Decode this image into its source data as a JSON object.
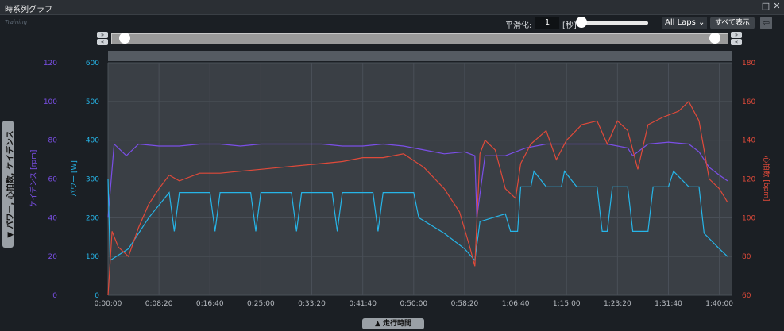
{
  "window": {
    "title": "時系列グラフ",
    "logo_text": "Training",
    "restore_icon": "□",
    "close_icon": "✕"
  },
  "toolbar": {
    "smoothing_label": "平滑化:",
    "smoothing_value": "1",
    "smoothing_unit": "[秒]",
    "laps_label": "All Laps",
    "show_all_label": "すべて表示",
    "exit_icon": "⇦",
    "nav_forward": "»",
    "nav_back": "«"
  },
  "tabs": {
    "side_label": "▼ パワー, 心拍数, ケイデンス",
    "bottom_label": "▲ 走行時間"
  },
  "colors": {
    "cadence": "#7b4fe8",
    "power": "#26b5e8",
    "heart_rate": "#e04a3a",
    "grid": "#4a5058",
    "plot_bg": "#3a3f45"
  },
  "chart_data": {
    "type": "line",
    "x_label": "走行時間",
    "x_ticks": [
      "0:00:00",
      "0:08:20",
      "0:16:40",
      "0:25:00",
      "0:33:20",
      "0:41:40",
      "0:50:00",
      "0:58:20",
      "1:06:40",
      "1:15:00",
      "1:23:20",
      "1:31:40",
      "1:40:00"
    ],
    "x_range_seconds": [
      0,
      6120
    ],
    "axes": {
      "cadence": {
        "label": "ケイデンス [rpm]",
        "range": [
          0,
          120
        ],
        "ticks": [
          "0",
          "20",
          "40",
          "60",
          "80",
          "100",
          "120"
        ]
      },
      "power": {
        "label": "パワー [W]",
        "range": [
          0,
          600
        ],
        "ticks": [
          "0",
          "100",
          "200",
          "300",
          "400",
          "500",
          "600"
        ]
      },
      "heart_rate": {
        "label": "心拍数 [bpm]",
        "range": [
          60,
          180
        ],
        "ticks": [
          "60",
          "80",
          "100",
          "120",
          "140",
          "160",
          "180"
        ]
      }
    },
    "series": [
      {
        "name": "ケイデンス",
        "axis": "cadence",
        "points": [
          [
            0,
            40
          ],
          [
            60,
            78
          ],
          [
            180,
            72
          ],
          [
            300,
            78
          ],
          [
            500,
            77
          ],
          [
            700,
            77
          ],
          [
            900,
            78
          ],
          [
            1100,
            78
          ],
          [
            1300,
            77
          ],
          [
            1500,
            78
          ],
          [
            1700,
            78
          ],
          [
            1900,
            78
          ],
          [
            2100,
            78
          ],
          [
            2300,
            77
          ],
          [
            2500,
            77
          ],
          [
            2700,
            78
          ],
          [
            2900,
            77
          ],
          [
            3100,
            75
          ],
          [
            3300,
            73
          ],
          [
            3500,
            74
          ],
          [
            3600,
            72
          ],
          [
            3620,
            40
          ],
          [
            3700,
            72
          ],
          [
            3900,
            72
          ],
          [
            4100,
            76
          ],
          [
            4300,
            78
          ],
          [
            4500,
            78
          ],
          [
            4700,
            78
          ],
          [
            4900,
            78
          ],
          [
            5100,
            76
          ],
          [
            5150,
            72
          ],
          [
            5300,
            78
          ],
          [
            5500,
            79
          ],
          [
            5700,
            78
          ],
          [
            5800,
            74
          ],
          [
            5900,
            66
          ],
          [
            6000,
            62
          ],
          [
            6080,
            59
          ]
        ]
      },
      {
        "name": "パワー",
        "axis": "power",
        "points": [
          [
            0,
            300
          ],
          [
            20,
            90
          ],
          [
            200,
            120
          ],
          [
            400,
            200
          ],
          [
            600,
            265
          ],
          [
            650,
            165
          ],
          [
            700,
            265
          ],
          [
            1000,
            265
          ],
          [
            1050,
            165
          ],
          [
            1100,
            265
          ],
          [
            1400,
            265
          ],
          [
            1450,
            165
          ],
          [
            1500,
            265
          ],
          [
            1800,
            265
          ],
          [
            1850,
            165
          ],
          [
            1900,
            265
          ],
          [
            2200,
            265
          ],
          [
            2250,
            165
          ],
          [
            2300,
            265
          ],
          [
            2600,
            265
          ],
          [
            2650,
            165
          ],
          [
            2700,
            265
          ],
          [
            3000,
            265
          ],
          [
            3050,
            200
          ],
          [
            3300,
            160
          ],
          [
            3500,
            120
          ],
          [
            3600,
            90
          ],
          [
            3650,
            190
          ],
          [
            3900,
            210
          ],
          [
            3950,
            165
          ],
          [
            4020,
            165
          ],
          [
            4050,
            280
          ],
          [
            4150,
            280
          ],
          [
            4180,
            320
          ],
          [
            4300,
            280
          ],
          [
            4450,
            280
          ],
          [
            4480,
            320
          ],
          [
            4600,
            280
          ],
          [
            4800,
            280
          ],
          [
            4850,
            165
          ],
          [
            4900,
            165
          ],
          [
            4950,
            280
          ],
          [
            5100,
            280
          ],
          [
            5150,
            165
          ],
          [
            5300,
            165
          ],
          [
            5350,
            280
          ],
          [
            5500,
            280
          ],
          [
            5550,
            320
          ],
          [
            5700,
            280
          ],
          [
            5800,
            280
          ],
          [
            5850,
            160
          ],
          [
            6000,
            120
          ],
          [
            6080,
            100
          ]
        ]
      },
      {
        "name": "心拍数",
        "axis": "heart_rate",
        "points": [
          [
            0,
            60
          ],
          [
            40,
            93
          ],
          [
            100,
            85
          ],
          [
            200,
            80
          ],
          [
            300,
            95
          ],
          [
            400,
            107
          ],
          [
            500,
            115
          ],
          [
            600,
            122
          ],
          [
            700,
            119
          ],
          [
            900,
            123
          ],
          [
            1100,
            123
          ],
          [
            1300,
            124
          ],
          [
            1500,
            125
          ],
          [
            1700,
            126
          ],
          [
            1900,
            127
          ],
          [
            2100,
            128
          ],
          [
            2300,
            129
          ],
          [
            2500,
            131
          ],
          [
            2700,
            131
          ],
          [
            2900,
            133
          ],
          [
            3100,
            126
          ],
          [
            3300,
            115
          ],
          [
            3450,
            103
          ],
          [
            3550,
            85
          ],
          [
            3600,
            75
          ],
          [
            3650,
            133
          ],
          [
            3700,
            140
          ],
          [
            3800,
            135
          ],
          [
            3900,
            115
          ],
          [
            4000,
            110
          ],
          [
            4050,
            128
          ],
          [
            4150,
            138
          ],
          [
            4300,
            145
          ],
          [
            4400,
            130
          ],
          [
            4500,
            140
          ],
          [
            4650,
            148
          ],
          [
            4800,
            150
          ],
          [
            4900,
            138
          ],
          [
            5000,
            150
          ],
          [
            5100,
            145
          ],
          [
            5200,
            125
          ],
          [
            5300,
            148
          ],
          [
            5450,
            152
          ],
          [
            5600,
            155
          ],
          [
            5700,
            160
          ],
          [
            5800,
            150
          ],
          [
            5900,
            120
          ],
          [
            6000,
            115
          ],
          [
            6080,
            108
          ]
        ]
      }
    ]
  }
}
